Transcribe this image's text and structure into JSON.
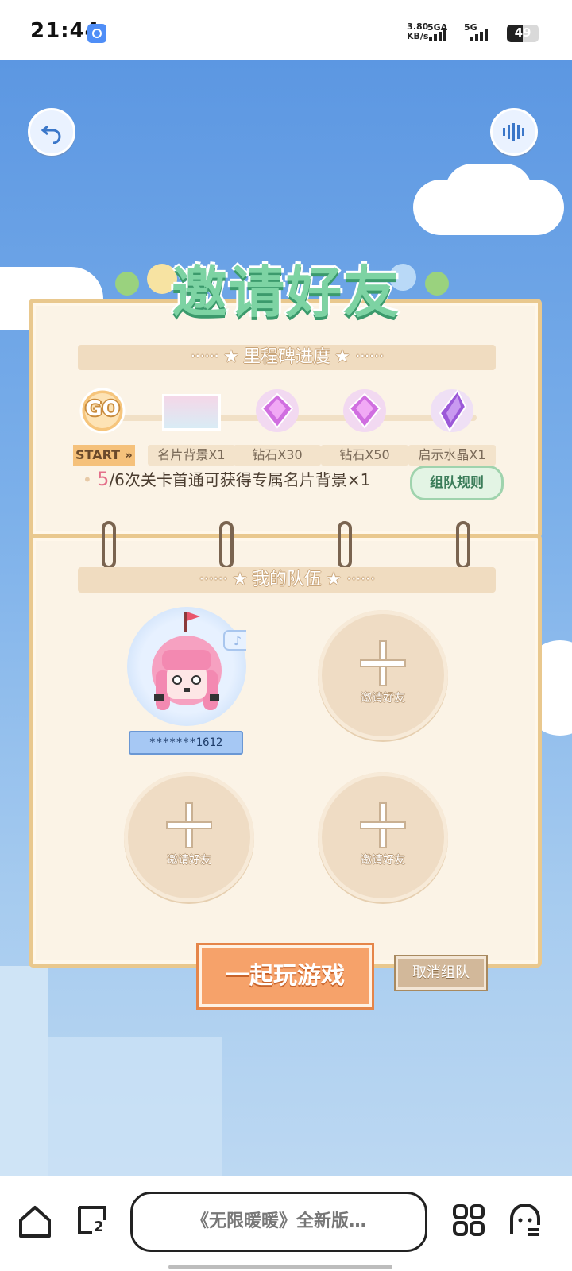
{
  "status_bar": {
    "time": "21:44",
    "net_speed_value": "3.80",
    "net_speed_unit": "KB/s",
    "network_1": "5GA",
    "network_2": "5G",
    "battery_level": "49",
    "battery_fraction": 0.49
  },
  "game": {
    "title": "邀请好友",
    "milestone": {
      "header": "里程碑进度",
      "start_icon_text": "GO",
      "start_label": "START »",
      "items": [
        {
          "label": "名片背景X1"
        },
        {
          "label": "钻石X30"
        },
        {
          "label": "钻石X50"
        },
        {
          "label": "启示水晶X1"
        }
      ],
      "progress_count": "5",
      "progress_text": "/6次关卡首通可获得专属名片背景×1",
      "rules_button": "组队规则"
    },
    "team": {
      "header": "我的队伍",
      "member_name": "*******1612",
      "invite_label": "邀请好友"
    },
    "play_button": "一起玩游戏",
    "cancel_button": "取消组队"
  },
  "bottom_bar": {
    "search_text": "《无限暖暖》全新版…",
    "tabs_count": "2"
  },
  "colors": {
    "sky": "#5c97e2",
    "panel": "#fbf3e6",
    "title": "#7dd3a3",
    "play": "#f6a26a"
  }
}
